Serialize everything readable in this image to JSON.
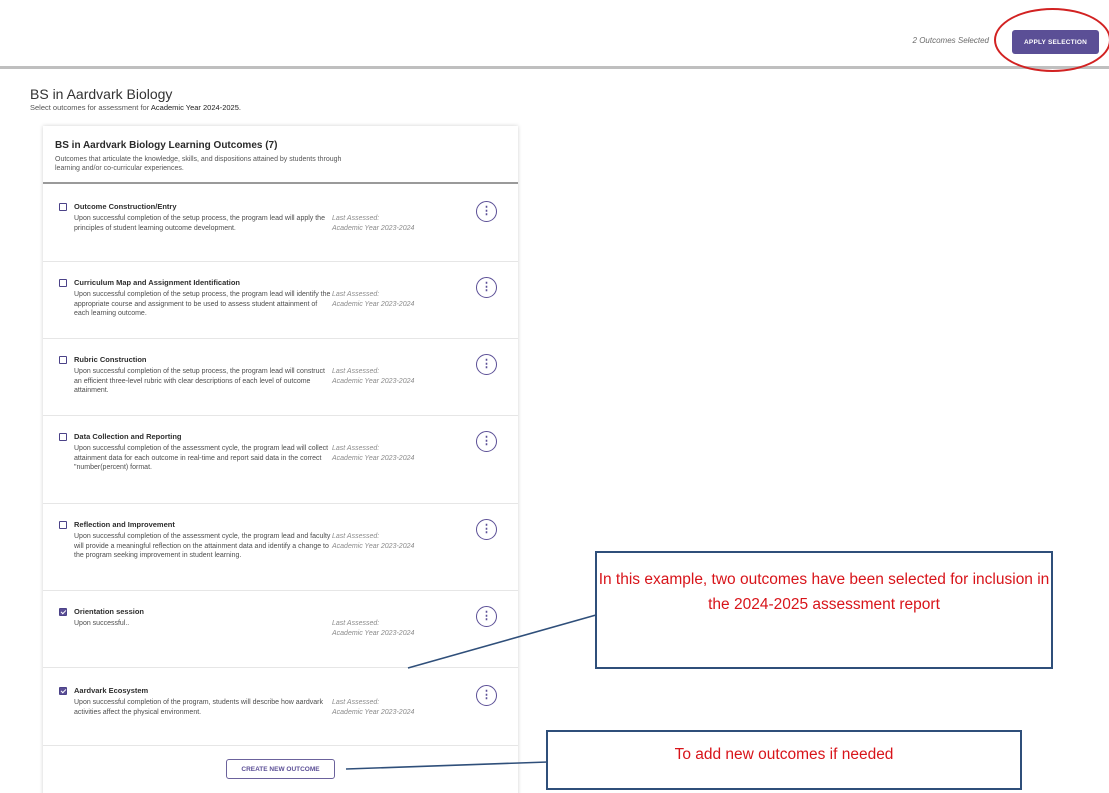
{
  "header": {
    "selected_count": "2 Outcomes Selected",
    "apply_label": "APPLY SELECTION",
    "accent_color": "#5b4f96"
  },
  "page": {
    "title": "BS in Aardvark Biology",
    "subtitle_prefix": "Select outcomes for assessment for ",
    "subtitle_year": "Academic Year 2024-2025."
  },
  "card": {
    "title": "BS in Aardvark Biology Learning Outcomes (7)",
    "description": "Outcomes that articulate the knowledge, skills, and dispositions attained by students through learning and/or co-curricular experiences."
  },
  "outcomes": [
    {
      "title": "Outcome Construction/Entry",
      "checked": false,
      "description": "Upon successful completion of the setup process, the program lead will apply the principles of student learning outcome development.",
      "last_label": "Last Assessed:",
      "last_value": "Academic Year 2023-2024"
    },
    {
      "title": "Curriculum Map and Assignment Identification",
      "checked": false,
      "description": "Upon successful completion of the setup process, the program lead will identify the appropriate course and assignment to be used to assess student attainment of each learning outcome.",
      "last_label": "Last Assessed:",
      "last_value": "Academic Year 2023-2024"
    },
    {
      "title": "Rubric Construction",
      "checked": false,
      "description": "Upon successful completion of the setup process, the program lead will construct an efficient three-level rubric with clear descriptions of each level of outcome attainment.",
      "last_label": "Last Assessed:",
      "last_value": "Academic Year 2023-2024"
    },
    {
      "title": "Data Collection and Reporting",
      "checked": false,
      "description": "Upon successful completion of the assessment cycle, the program lead will collect attainment data for each outcome in real-time and report said data in the correct \"number(percent) format.",
      "last_label": "Last Assessed:",
      "last_value": "Academic Year 2023-2024"
    },
    {
      "title": "Reflection and Improvement",
      "checked": false,
      "description": "Upon successful completion of the assessment cycle, the program lead and faculty will provide a meaningful reflection on the attainment data and identify a change to the program seeking improvement in student learning.",
      "last_label": "Last Assessed:",
      "last_value": "Academic Year 2023-2024"
    },
    {
      "title": "Orientation session",
      "checked": true,
      "description": "Upon successful..",
      "last_label": "Last Assessed:",
      "last_value": "Academic Year 2023-2024"
    },
    {
      "title": "Aardvark Ecosystem",
      "checked": true,
      "description": "Upon successful completion of the program, students will describe how aardvark activities affect the physical environment.",
      "last_label": "Last Assessed:",
      "last_value": "Academic Year 2023-2024"
    }
  ],
  "create_label": "CREATE NEW OUTCOME",
  "annotations": {
    "callout_selected": "In this example, two outcomes have been selected for inclusion in the 2024-2025 assessment report",
    "callout_create": "To add new outcomes if needed",
    "highlight_color": "#d22222",
    "callout_text_color": "#d8141a"
  }
}
